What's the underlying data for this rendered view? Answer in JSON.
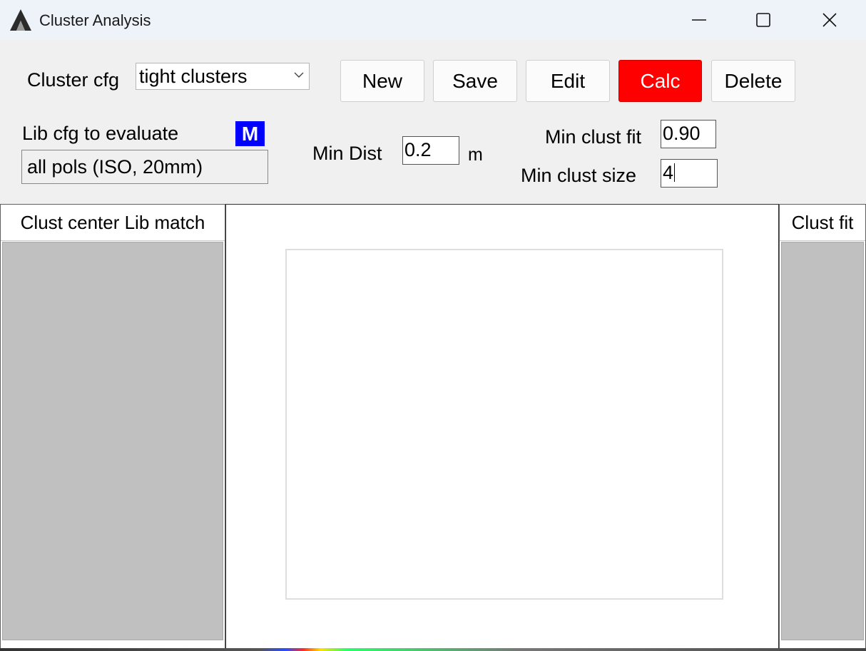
{
  "window": {
    "title": "Cluster Analysis",
    "controls": {
      "minimize_icon": "minimize-icon",
      "maximize_icon": "maximize-icon",
      "close_icon": "close-icon"
    }
  },
  "toolbar": {
    "cluster_cfg_label": "Cluster cfg",
    "cluster_cfg_value": "tight clusters",
    "buttons": {
      "new": "New",
      "save": "Save",
      "edit": "Edit",
      "calc": "Calc",
      "delete": "Delete"
    }
  },
  "params": {
    "lib_cfg_label": "Lib cfg to evaluate",
    "m_badge": "M",
    "lib_cfg_value": "all pols (ISO, 20mm)",
    "min_dist_label": "Min Dist",
    "min_dist_value": "0.2",
    "min_dist_unit": "m",
    "min_clust_fit_label": "Min clust fit",
    "min_clust_fit_value": "0.90",
    "min_clust_size_label": "Min clust size",
    "min_clust_size_value": "4"
  },
  "panels": {
    "left_header": "Clust center Lib match",
    "right_header": "Clust fit"
  },
  "colors": {
    "calc_button": "#ff0000",
    "m_badge": "#0000ff",
    "list_body": "#c0c0c0"
  }
}
